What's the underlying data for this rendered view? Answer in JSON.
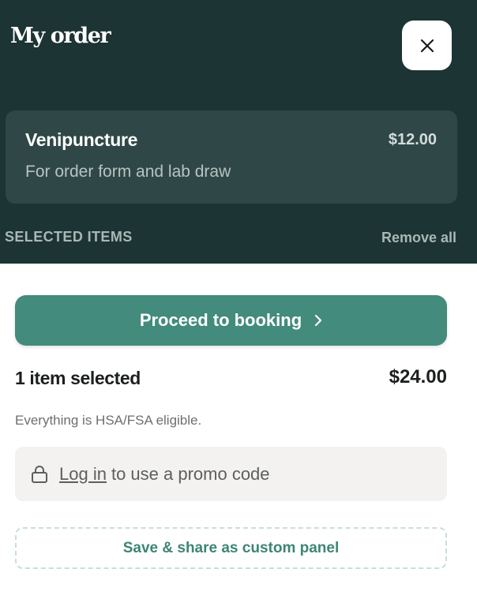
{
  "header": {
    "title": "My order",
    "close_icon": "close-icon"
  },
  "order_item": {
    "name": "Venipuncture",
    "price": "$12.00",
    "description": "For order form and lab draw"
  },
  "selected_section": {
    "label": "SELECTED ITEMS",
    "remove_all_label": "Remove all"
  },
  "booking": {
    "proceed_label": "Proceed to booking",
    "proceed_icon": "chevron-right-icon"
  },
  "summary": {
    "count_label": "1 item selected",
    "total": "$24.00",
    "hsa_note": "Everything is HSA/FSA eligible."
  },
  "promo": {
    "lock_icon": "lock-icon",
    "login_link": "Log in",
    "text": "to use a promo code"
  },
  "save_panel": {
    "label": "Save & share as custom panel"
  },
  "colors": {
    "header_bg": "#1c3433",
    "card_bg": "#2f4847",
    "accent": "#438b7c",
    "promo_bg": "#f3f2f0"
  }
}
